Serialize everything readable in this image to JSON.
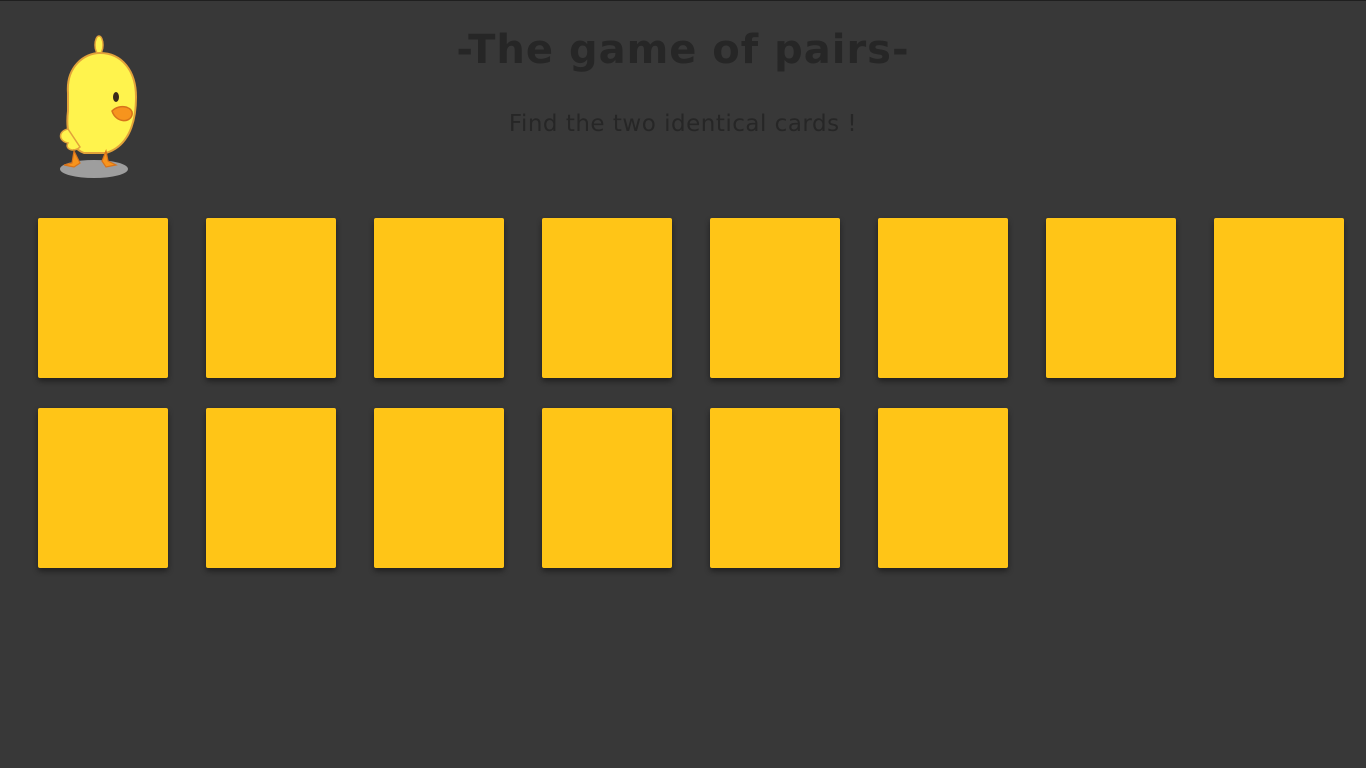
{
  "header": {
    "title": "-The game of pairs-",
    "subtitle": "Find the two identical cards !"
  },
  "mascot": {
    "icon": "duckling-icon"
  },
  "board": {
    "card_count": 14,
    "card_state": "face-down",
    "card_color": "#ffc517"
  },
  "colors": {
    "background": "#383838",
    "text": "#262626",
    "card_back": "#ffc517"
  }
}
